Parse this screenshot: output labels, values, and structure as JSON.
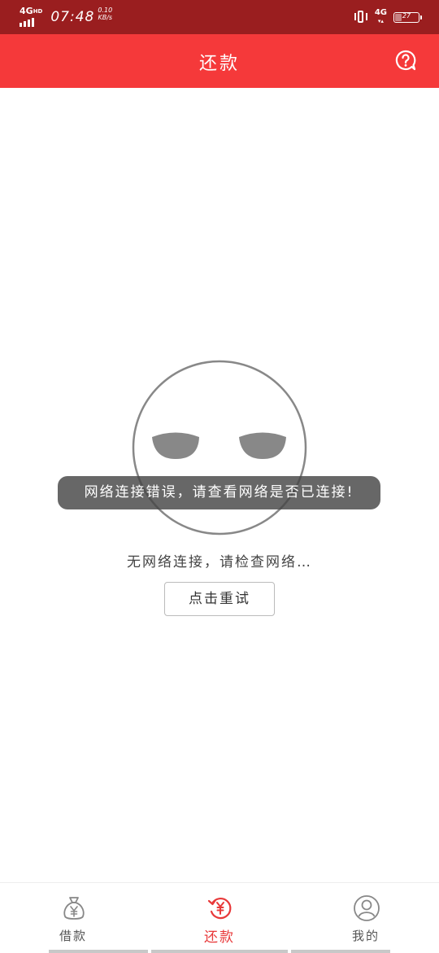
{
  "status_bar": {
    "network": "4G",
    "network_hd": "HD",
    "time": "07:48",
    "speed_value": "0.10",
    "speed_unit": "KB/s",
    "mobile_type": "4G",
    "battery": "27"
  },
  "navbar": {
    "title": "还款",
    "help_icon": "question-bubble-icon"
  },
  "main": {
    "toast": "网络连接错误，请查看网络是否已连接!",
    "empty_message": "无网络连接，请检查网络…",
    "retry_label": "点击重试",
    "empty_icon": "sleepy-face-icon"
  },
  "tabbar": {
    "tabs": [
      {
        "label": "借款",
        "icon": "money-bag-icon",
        "active": false
      },
      {
        "label": "还款",
        "icon": "yen-refresh-icon",
        "active": true
      },
      {
        "label": "我的",
        "icon": "user-circle-icon",
        "active": false
      }
    ]
  },
  "colors": {
    "status_bar": "#9a1e1f",
    "navbar": "#f5393a",
    "accent": "#e8393a"
  }
}
